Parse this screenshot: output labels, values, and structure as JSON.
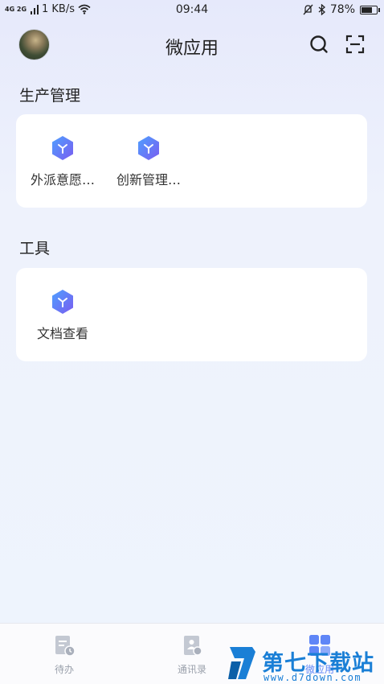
{
  "status_bar": {
    "network": "4G 2G",
    "speed": "1 KB/s",
    "time": "09:44",
    "battery": "78%",
    "battery_level": 0.78
  },
  "header": {
    "title": "微应用"
  },
  "sections": [
    {
      "title": "生产管理",
      "apps": [
        {
          "label": "外派意愿…"
        },
        {
          "label": "创新管理…"
        }
      ]
    },
    {
      "title": "工具",
      "apps": [
        {
          "label": "文档查看"
        }
      ]
    }
  ],
  "bottom_nav": [
    {
      "label": "待办",
      "icon": "todo-icon"
    },
    {
      "label": "通讯录",
      "icon": "contacts-icon"
    },
    {
      "label": "微应用",
      "icon": "apps-grid-icon",
      "active": true
    }
  ],
  "watermark": {
    "text": "第七下载站",
    "url": "www.d7down.com"
  },
  "colors": {
    "accent": "#5f86f7",
    "app_icon_gradient_start": "#4ea0ff",
    "app_icon_gradient_end": "#7a5cf0",
    "watermark": "#1a7fd6"
  }
}
